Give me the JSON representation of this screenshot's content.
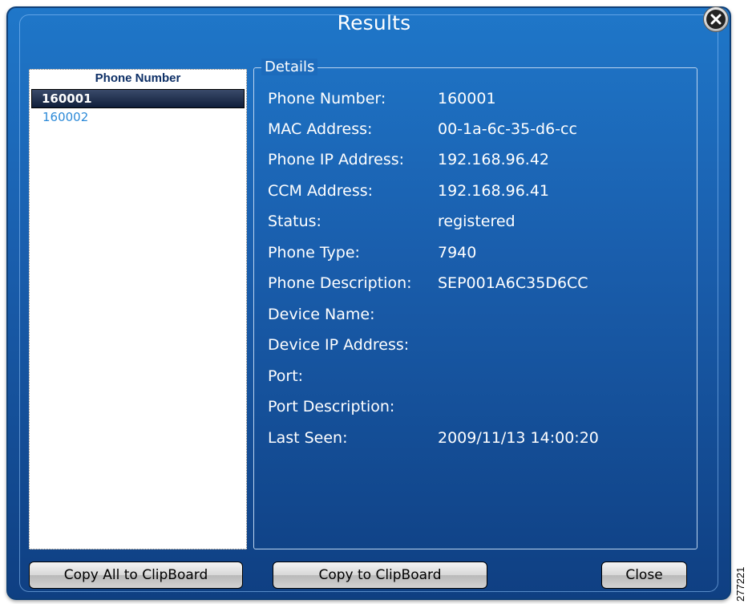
{
  "window": {
    "title": "Results"
  },
  "list": {
    "header": "Phone Number",
    "items": [
      {
        "label": "160001",
        "selected": true
      },
      {
        "label": "160002",
        "selected": false
      }
    ]
  },
  "details": {
    "legend": "Details",
    "rows": [
      {
        "label": "Phone Number:",
        "value": "160001"
      },
      {
        "label": "MAC Address:",
        "value": "00-1a-6c-35-d6-cc"
      },
      {
        "label": "Phone IP Address:",
        "value": "192.168.96.42"
      },
      {
        "label": "CCM Address:",
        "value": "192.168.96.41"
      },
      {
        "label": "Status:",
        "value": "registered"
      },
      {
        "label": "Phone Type:",
        "value": "7940"
      },
      {
        "label": "Phone Description:",
        "value": "SEP001A6C35D6CC"
      },
      {
        "label": "Device Name:",
        "value": ""
      },
      {
        "label": "Device IP Address:",
        "value": ""
      },
      {
        "label": "Port:",
        "value": ""
      },
      {
        "label": "Port Description:",
        "value": ""
      },
      {
        "label": "Last Seen:",
        "value": "2009/11/13 14:00:20"
      }
    ]
  },
  "buttons": {
    "copy_all": "Copy All to ClipBoard",
    "copy": "Copy to ClipBoard",
    "close": "Close"
  },
  "figure_id": "277221",
  "icons": {
    "close": "close-circle-icon"
  },
  "colors": {
    "dialog_top": "#1f77c9",
    "dialog_bottom": "#0f3f82",
    "list_text": "#2c8ad8",
    "selected_bg": "#0f1e3a"
  }
}
